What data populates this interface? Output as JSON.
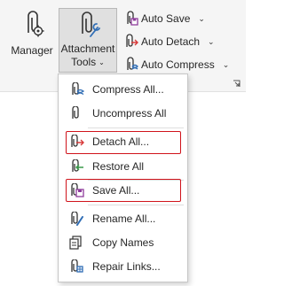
{
  "ribbon": {
    "manager_label": "Manager",
    "attachment_tools_label_line1": "Attachment",
    "attachment_tools_label_line2": "Tools",
    "small_buttons": [
      {
        "label": "Auto Save",
        "icon": "paperclip-save-icon"
      },
      {
        "label": "Auto Detach",
        "icon": "paperclip-detach-icon"
      },
      {
        "label": "Auto Compress",
        "icon": "paperclip-compress-icon"
      }
    ]
  },
  "menu": {
    "items": [
      {
        "label": "Compress All...",
        "icon": "compress-icon"
      },
      {
        "label": "Uncompress All",
        "icon": "uncompress-icon"
      },
      {
        "label": "Detach All...",
        "icon": "detach-icon"
      },
      {
        "label": "Restore All",
        "icon": "restore-icon"
      },
      {
        "label": "Save All...",
        "icon": "save-icon"
      },
      {
        "label": "Rename All...",
        "icon": "rename-icon"
      },
      {
        "label": "Copy Names",
        "icon": "copy-names-icon"
      },
      {
        "label": "Repair Links...",
        "icon": "repair-links-icon"
      }
    ]
  },
  "colors": {
    "highlight": "#d0131b",
    "accent_blue": "#2f6db5",
    "icon_red": "#d83b3b",
    "icon_purple": "#8e3c9c",
    "icon_green": "#3a9a4a"
  }
}
